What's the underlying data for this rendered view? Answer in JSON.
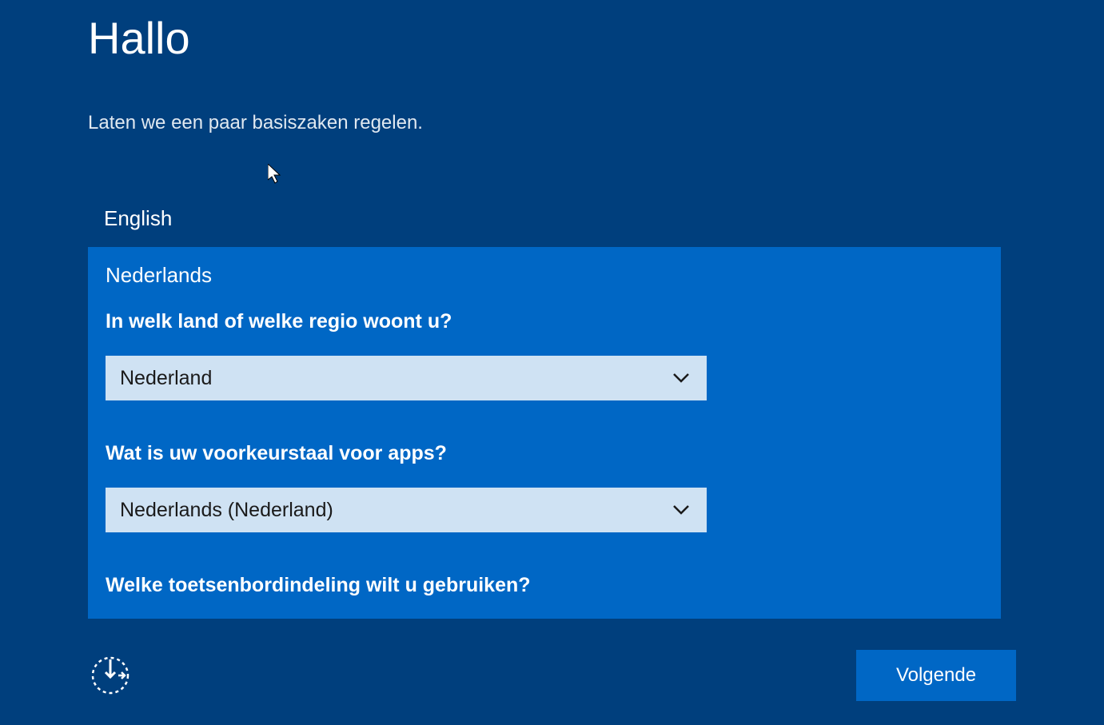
{
  "header": {
    "title": "Hallo",
    "subtitle": "Laten we een paar basiszaken regelen."
  },
  "language_unselected": "English",
  "panel": {
    "language_selected": "Nederlands",
    "q1": "In welk land of welke regio woont u?",
    "q1_value": "Nederland",
    "q2": "Wat is uw voorkeurstaal voor apps?",
    "q2_value": "Nederlands (Nederland)",
    "q3": "Welke toetsenbordindeling wilt u gebruiken?"
  },
  "footer": {
    "next": "Volgende"
  }
}
